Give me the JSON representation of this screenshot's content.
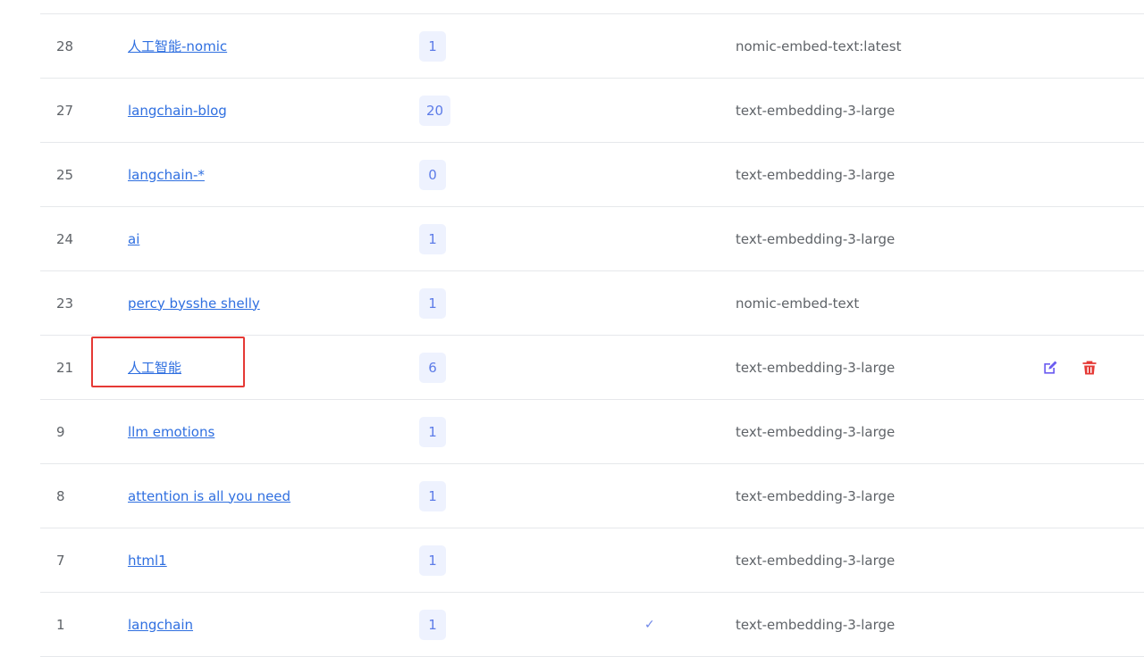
{
  "rows": [
    {
      "id": "28",
      "name": "人工智能-nomic",
      "count": "1",
      "model": "nomic-embed-text:latest",
      "checked": ""
    },
    {
      "id": "27",
      "name": "langchain-blog",
      "count": "20",
      "model": "text-embedding-3-large",
      "checked": ""
    },
    {
      "id": "25",
      "name": "langchain-*",
      "count": "0",
      "model": "text-embedding-3-large",
      "checked": ""
    },
    {
      "id": "24",
      "name": "ai",
      "count": "1",
      "model": "text-embedding-3-large",
      "checked": ""
    },
    {
      "id": "23",
      "name": "percy bysshe shelly",
      "count": "1",
      "model": "nomic-embed-text",
      "checked": ""
    },
    {
      "id": "21",
      "name": "人工智能",
      "count": "6",
      "model": "text-embedding-3-large",
      "checked": ""
    },
    {
      "id": "9",
      "name": "llm emotions",
      "count": "1",
      "model": "text-embedding-3-large",
      "checked": ""
    },
    {
      "id": "8",
      "name": "attention is all you need",
      "count": "1",
      "model": "text-embedding-3-large",
      "checked": ""
    },
    {
      "id": "7",
      "name": "html1",
      "count": "1",
      "model": "text-embedding-3-large",
      "checked": ""
    },
    {
      "id": "1",
      "name": "langchain",
      "count": "1",
      "model": "text-embedding-3-large",
      "checked": "✓"
    }
  ],
  "actions": {
    "edit_icon": "edit-icon",
    "delete_icon": "trash-icon",
    "edit_color": "#6b5cf0",
    "delete_color": "#e53935"
  },
  "colors": {
    "link": "#2f6fe0",
    "badge_bg": "#eef2fe",
    "badge_text": "#5d7ce8",
    "highlight": "#e53935"
  }
}
